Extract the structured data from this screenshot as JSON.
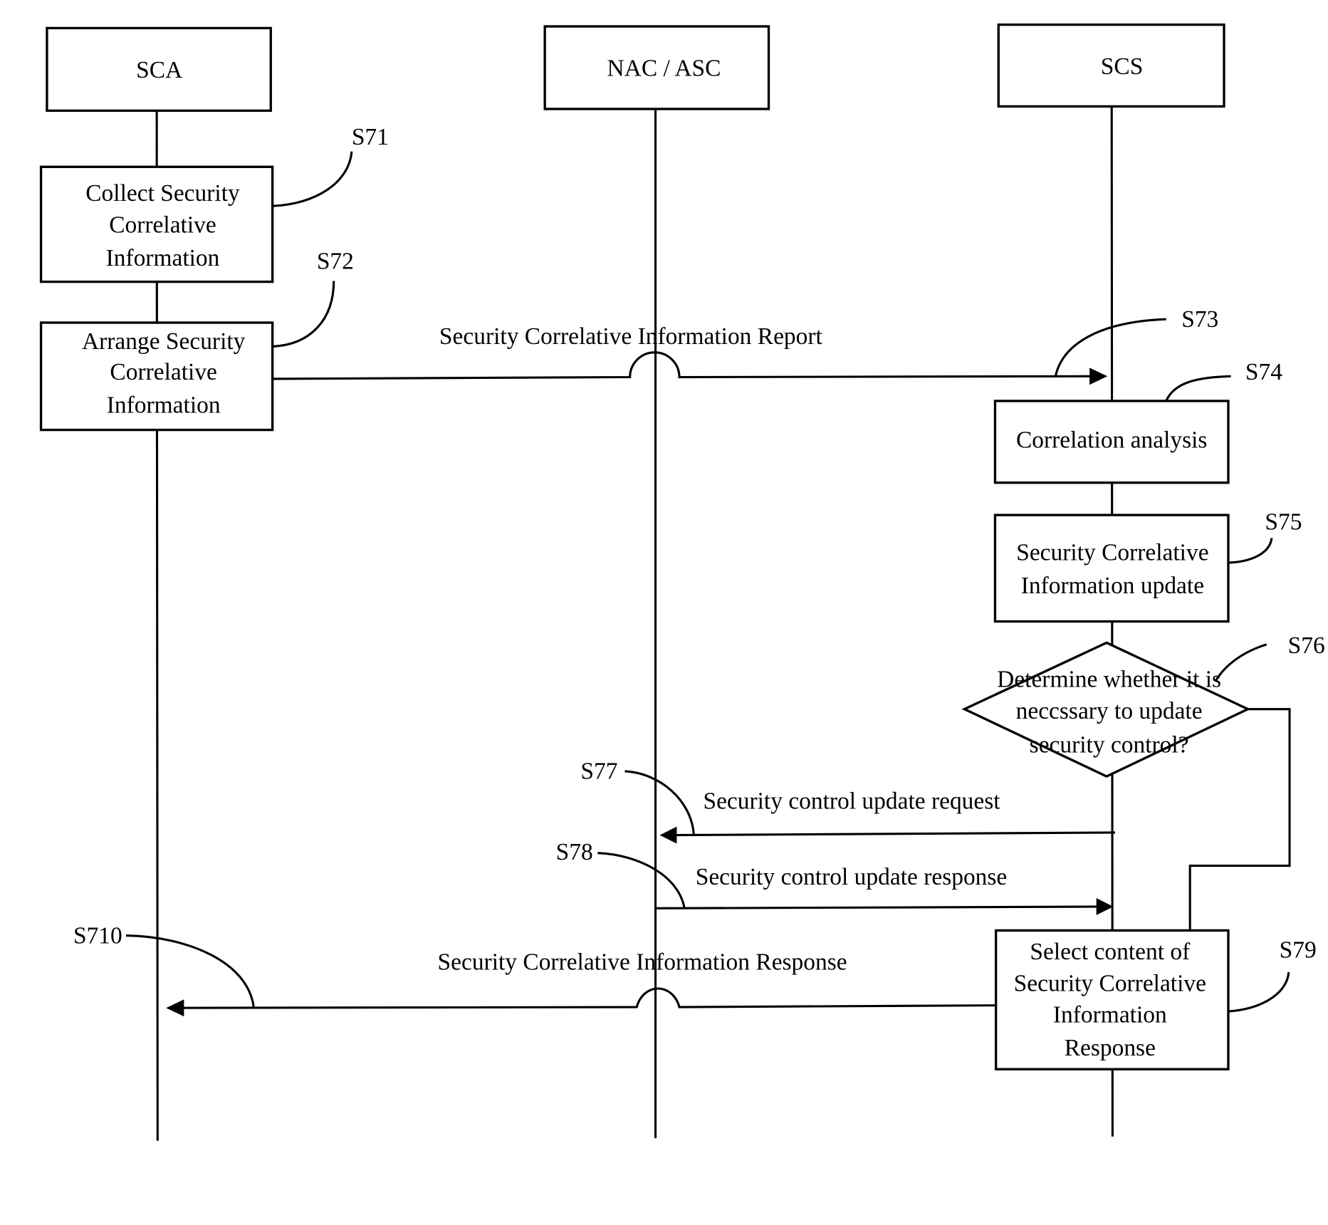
{
  "diagram": {
    "type": "sequence-flow",
    "participants": [
      {
        "id": "sca",
        "label": "SCA"
      },
      {
        "id": "nac",
        "label": "NAC / ASC"
      },
      {
        "id": "scs",
        "label": "SCS"
      }
    ],
    "steps": {
      "s71": {
        "tag": "S71",
        "lines": [
          "Collect Security",
          "Correlative",
          "Information"
        ]
      },
      "s72": {
        "tag": "S72",
        "lines": [
          "Arrange Security",
          "Correlative",
          "Information"
        ]
      },
      "s73": {
        "tag": "S73"
      },
      "s74": {
        "tag": "S74",
        "lines": [
          "Correlation analysis"
        ]
      },
      "s75": {
        "tag": "S75",
        "lines": [
          "Security Correlative",
          "Information update"
        ]
      },
      "s76": {
        "tag": "S76",
        "lines": [
          "Determine whether it is",
          "neccssary to update",
          "security control?"
        ]
      },
      "s77": {
        "tag": "S77"
      },
      "s78": {
        "tag": "S78"
      },
      "s79": {
        "tag": "S79",
        "lines": [
          "Select content of",
          "Security Correlative",
          "Information",
          "Response"
        ]
      },
      "s710": {
        "tag": "S710"
      }
    },
    "messages": {
      "report": {
        "label": "Security Correlative Information Report",
        "from": "SCA",
        "to": "SCS"
      },
      "update_request": {
        "label": "Security control update request",
        "from": "SCS",
        "to": "NAC / ASC"
      },
      "update_response": {
        "label": "Security control update response",
        "from": "NAC / ASC",
        "to": "SCS"
      },
      "info_response": {
        "label": "Security Correlative Information Response",
        "from": "SCS",
        "to": "SCA"
      }
    }
  }
}
